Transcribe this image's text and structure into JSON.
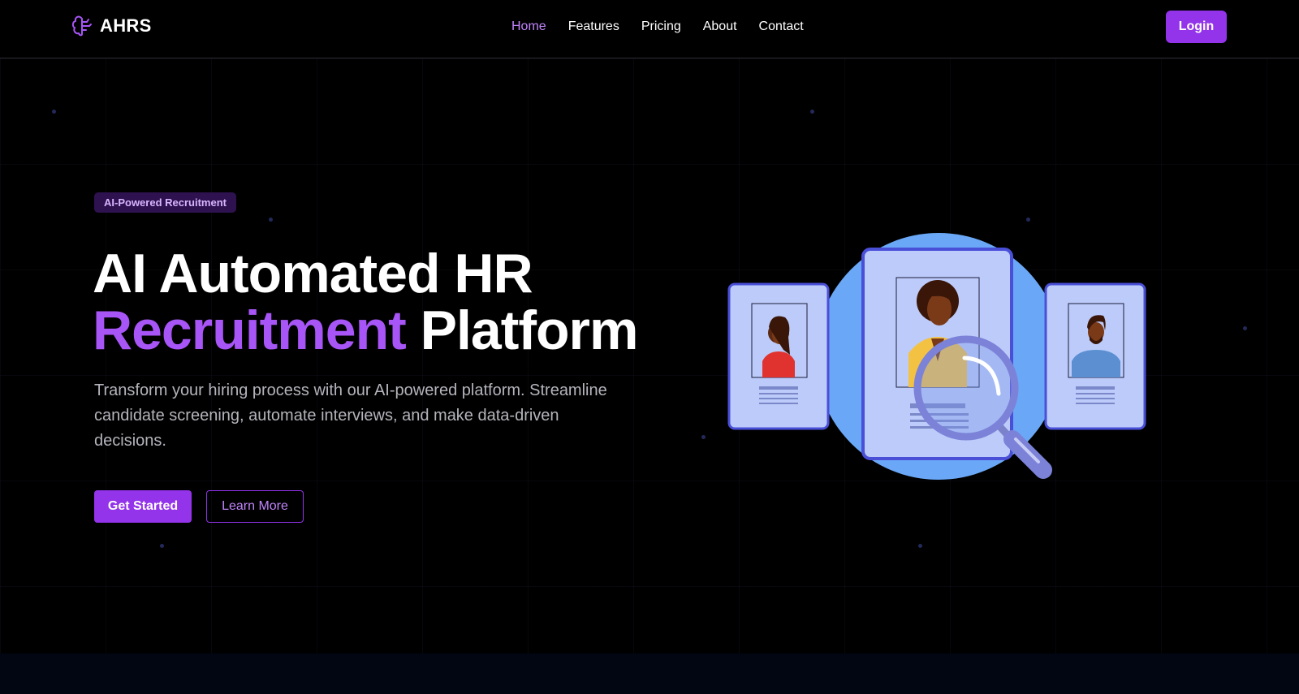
{
  "nav": {
    "brand": "AHRS",
    "links": [
      "Home",
      "Features",
      "Pricing",
      "About",
      "Contact"
    ],
    "active": "Home",
    "login_label": "Login"
  },
  "hero": {
    "badge": "AI-Powered Recruitment",
    "title_line1": "AI Automated HR",
    "title_accent": "Recruitment",
    "title_rest": "Platform",
    "description": "Transform your hiring process with our AI-powered platform. Streamline candidate screening, automate interviews, and make data-driven decisions.",
    "primary_cta": "Get Started",
    "secondary_cta": "Learn More"
  },
  "colors": {
    "accent": "#9333ea",
    "accent_light": "#a855f7",
    "background": "#000000",
    "illustration_circle": "#6aa8f7",
    "card_fill": "#bccbfa",
    "card_stroke": "#4a4fd8"
  },
  "icons": {
    "brand": "brain-icon",
    "illustration": "magnifier-candidate-profiles"
  }
}
